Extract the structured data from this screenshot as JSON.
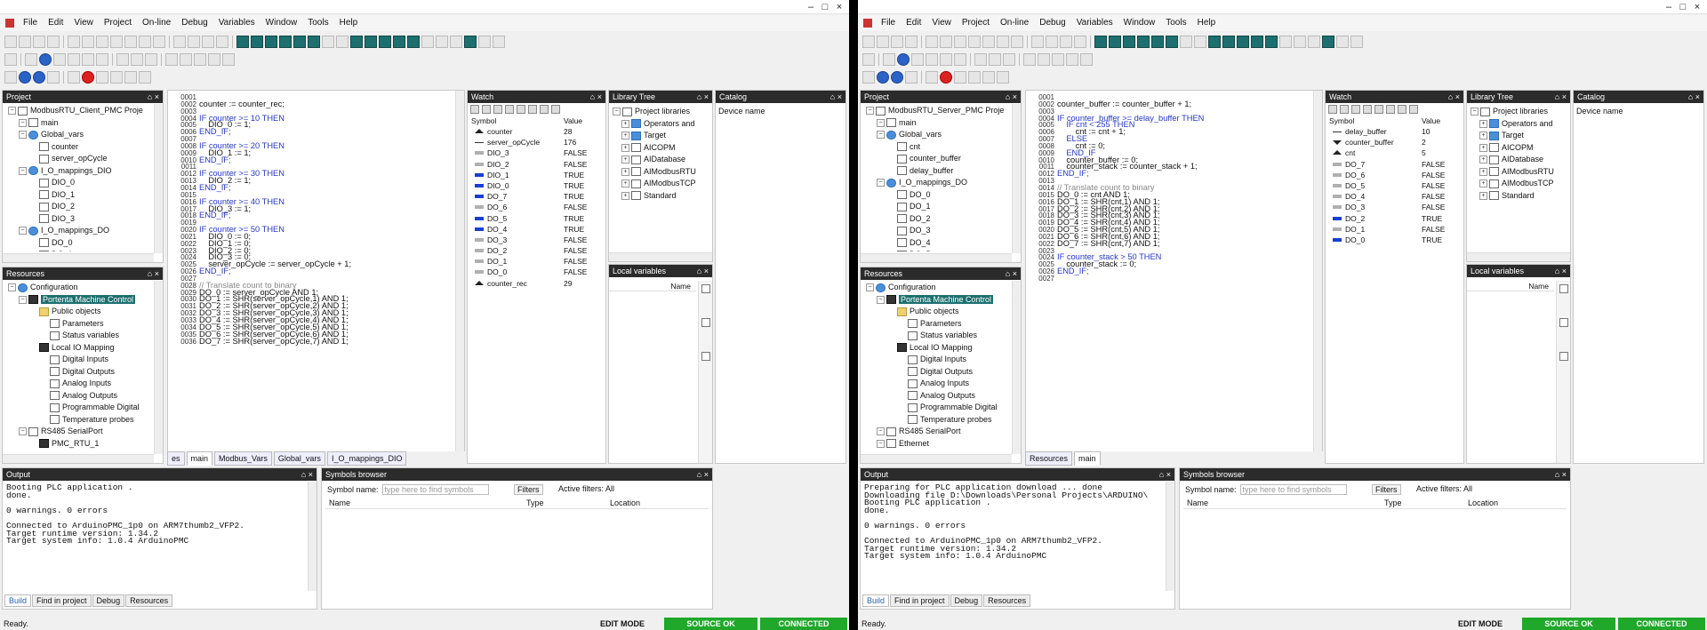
{
  "windows": [
    {
      "id": "left",
      "menu": [
        "File",
        "Edit",
        "View",
        "Project",
        "On-line",
        "Debug",
        "Variables",
        "Window",
        "Tools",
        "Help"
      ],
      "project_panel": {
        "title": "Project",
        "tree": [
          {
            "label": "ModbusRTU_Client_PMC Proje",
            "depth": 0,
            "icon": "project-icon"
          },
          {
            "label": "main",
            "depth": 1,
            "icon": "program-icon"
          },
          {
            "label": "Global_vars",
            "depth": 1,
            "icon": "globe-icon"
          },
          {
            "label": "counter",
            "depth": 2,
            "icon": "variable-icon"
          },
          {
            "label": "server_opCycle",
            "depth": 2,
            "icon": "variable-icon"
          },
          {
            "label": "I_O_mappings_DIO",
            "depth": 1,
            "icon": "globe-icon"
          },
          {
            "label": "DIO_0",
            "depth": 2,
            "icon": "io-icon"
          },
          {
            "label": "DIO_1",
            "depth": 2,
            "icon": "io-icon"
          },
          {
            "label": "DIO_2",
            "depth": 2,
            "icon": "io-icon"
          },
          {
            "label": "DIO_3",
            "depth": 2,
            "icon": "io-icon"
          },
          {
            "label": "I_O_mappings_DO",
            "depth": 1,
            "icon": "globe-icon"
          },
          {
            "label": "DO_0",
            "depth": 2,
            "icon": "io-icon"
          },
          {
            "label": "DO_1",
            "depth": 2,
            "icon": "io-icon"
          }
        ]
      },
      "resources_panel": {
        "title": "Resources",
        "tree": [
          {
            "label": "Configuration",
            "depth": 0,
            "icon": "config-icon"
          },
          {
            "label": "Portenta Machine Control",
            "depth": 1,
            "icon": "board-icon",
            "selected": true
          },
          {
            "label": "Public objects",
            "depth": 2,
            "icon": "folder-icon"
          },
          {
            "label": "Parameters",
            "depth": 3,
            "icon": "table-icon"
          },
          {
            "label": "Status variables",
            "depth": 3,
            "icon": "table-icon"
          },
          {
            "label": "Local IO Mapping",
            "depth": 2,
            "icon": "io-map-icon"
          },
          {
            "label": "Digital Inputs",
            "depth": 3,
            "icon": "io-icon"
          },
          {
            "label": "Digital Outputs",
            "depth": 3,
            "icon": "io-icon"
          },
          {
            "label": "Analog Inputs",
            "depth": 3,
            "icon": "io-icon"
          },
          {
            "label": "Analog Outputs",
            "depth": 3,
            "icon": "io-icon"
          },
          {
            "label": "Programmable Digital",
            "depth": 3,
            "icon": "io-icon"
          },
          {
            "label": "Temperature probes",
            "depth": 3,
            "icon": "io-icon"
          },
          {
            "label": "RS485 SerialPort",
            "depth": 1,
            "icon": "port-icon"
          },
          {
            "label": "PMC_RTU_1",
            "depth": 2,
            "icon": "device-icon"
          }
        ]
      },
      "editor": {
        "line_numbers": [
          "0001",
          "0002",
          "0003",
          "0004",
          "0005",
          "0006",
          "0007",
          "0008",
          "0009",
          "0010",
          "0011",
          "0012",
          "0013",
          "0014",
          "0015",
          "0016",
          "0017",
          "0018",
          "0019",
          "0020",
          "0021",
          "0022",
          "0023",
          "0024",
          "0025",
          "0026",
          "0027",
          "0028",
          "0029",
          "0030",
          "0031",
          "0032",
          "0033",
          "0034",
          "0035",
          "0036"
        ],
        "lines": [
          "",
          "counter := counter_rec;",
          "",
          "IF counter >= 10 THEN",
          "    DIO_0 := 1;",
          "END_IF;",
          "",
          "IF counter >= 20 THEN",
          "    DIO_1 := 1;",
          "END_IF;",
          "",
          "IF counter >= 30 THEN",
          "    DIO_2 := 1;",
          "END_IF;",
          "",
          "IF counter >= 40 THEN",
          "    DIO_3 := 1;",
          "END_IF;",
          "",
          "IF counter >= 50 THEN",
          "    DIO_0 := 0;",
          "    DIO_1 := 0;",
          "    DIO_2 := 0;",
          "    DIO_3 := 0;",
          "    server_opCycle := server_opCycle + 1;",
          "END_IF;",
          "",
          "// Translate count to binary",
          "DO_0 := server_opCycle AND 1;",
          "DO_1 := SHR(server_opCycle,1) AND 1;",
          "DO_2 := SHR(server_opCycle,2) AND 1;",
          "DO_3 := SHR(server_opCycle,3) AND 1;",
          "DO_4 := SHR(server_opCycle,4) AND 1;",
          "DO_5 := SHR(server_opCycle,5) AND 1;",
          "DO_6 := SHR(server_opCycle,6) AND 1;",
          "DO_7 := SHR(server_opCycle,7) AND 1;"
        ],
        "tabs": [
          "es",
          "main",
          "Modbus_Vars",
          "Global_vars",
          "I_O_mappings_DIO"
        ]
      },
      "watch": {
        "title": "Watch",
        "col_symbol": "Symbol",
        "col_value": "Value",
        "rows": [
          {
            "name": "counter",
            "value": "28",
            "marker": "up"
          },
          {
            "name": "server_opCycle",
            "value": "176",
            "marker": "line"
          },
          {
            "name": "DIO_3",
            "value": "FALSE",
            "marker": "gray"
          },
          {
            "name": "DIO_2",
            "value": "FALSE",
            "marker": "gray"
          },
          {
            "name": "DIO_1",
            "value": "TRUE",
            "marker": "blue"
          },
          {
            "name": "DIO_0",
            "value": "TRUE",
            "marker": "blue"
          },
          {
            "name": "DO_7",
            "value": "TRUE",
            "marker": "blue"
          },
          {
            "name": "DO_6",
            "value": "FALSE",
            "marker": "gray"
          },
          {
            "name": "DO_5",
            "value": "TRUE",
            "marker": "blue"
          },
          {
            "name": "DO_4",
            "value": "TRUE",
            "marker": "blue"
          },
          {
            "name": "DO_3",
            "value": "FALSE",
            "marker": "gray"
          },
          {
            "name": "DO_2",
            "value": "FALSE",
            "marker": "gray"
          },
          {
            "name": "DO_1",
            "value": "FALSE",
            "marker": "gray"
          },
          {
            "name": "DO_0",
            "value": "FALSE",
            "marker": "gray"
          },
          {
            "name": "counter_rec",
            "value": "29",
            "marker": "up"
          }
        ]
      },
      "library": {
        "title": "Library Tree",
        "root": "Project libraries",
        "items": [
          "Operators and",
          "Target",
          "AICOPM",
          "AIDatabase",
          "AIModbusRTU",
          "AIModbusTCP",
          "Standard"
        ]
      },
      "local_vars": {
        "title": "Local variables",
        "col_name": "Name"
      },
      "catalog": {
        "title": "Catalog",
        "label": "Device name"
      },
      "output": {
        "title": "Output",
        "lines": [
          "Booting PLC application .",
          "done.",
          "",
          "0 warnings. 0 errors",
          "",
          "Connected to ArduinoPMC_1p0 on ARM7thumb2_VFP2.",
          "Target runtime version: 1.34.2",
          "Target system info: 1.0.4 ArduinoPMC"
        ],
        "tabs": [
          "Build",
          "Find in project",
          "Debug",
          "Resources"
        ]
      },
      "symbols": {
        "title": "Symbols browser",
        "name_label": "Symbol name:",
        "placeholder": "type here to find symbols",
        "filters": "Filters",
        "active_filters": "Active filters: All",
        "col_name": "Name",
        "col_type": "Type",
        "col_location": "Location"
      },
      "status": {
        "ready": "Ready.",
        "mode": "EDIT MODE",
        "source": "SOURCE OK",
        "conn": "CONNECTED"
      }
    },
    {
      "id": "right",
      "menu": [
        "File",
        "Edit",
        "View",
        "Project",
        "On-line",
        "Debug",
        "Variables",
        "Window",
        "Tools",
        "Help"
      ],
      "project_panel": {
        "title": "Project",
        "tree": [
          {
            "label": "ModbusRTU_Server_PMC Proje",
            "depth": 0,
            "icon": "project-icon"
          },
          {
            "label": "main",
            "depth": 1,
            "icon": "program-icon"
          },
          {
            "label": "Global_vars",
            "depth": 1,
            "icon": "globe-icon"
          },
          {
            "label": "cnt",
            "depth": 2,
            "icon": "variable-icon"
          },
          {
            "label": "counter_buffer",
            "depth": 2,
            "icon": "variable-icon"
          },
          {
            "label": "delay_buffer",
            "depth": 2,
            "icon": "variable-icon"
          },
          {
            "label": "I_O_mappings_DO",
            "depth": 1,
            "icon": "globe-icon"
          },
          {
            "label": "DO_0",
            "depth": 2,
            "icon": "io-icon"
          },
          {
            "label": "DO_1",
            "depth": 2,
            "icon": "io-icon"
          },
          {
            "label": "DO_2",
            "depth": 2,
            "icon": "io-icon"
          },
          {
            "label": "DO_3",
            "depth": 2,
            "icon": "io-icon"
          },
          {
            "label": "DO_4",
            "depth": 2,
            "icon": "io-icon"
          },
          {
            "label": "DO_5",
            "depth": 2,
            "icon": "io-icon"
          }
        ]
      },
      "resources_panel": {
        "title": "Resources",
        "tree": [
          {
            "label": "Configuration",
            "depth": 0,
            "icon": "config-icon"
          },
          {
            "label": "Portenta Machine Control",
            "depth": 1,
            "icon": "board-icon",
            "selected": true
          },
          {
            "label": "Public objects",
            "depth": 2,
            "icon": "folder-icon"
          },
          {
            "label": "Parameters",
            "depth": 3,
            "icon": "table-icon"
          },
          {
            "label": "Status variables",
            "depth": 3,
            "icon": "table-icon"
          },
          {
            "label": "Local IO Mapping",
            "depth": 2,
            "icon": "io-map-icon"
          },
          {
            "label": "Digital Inputs",
            "depth": 3,
            "icon": "io-icon"
          },
          {
            "label": "Digital Outputs",
            "depth": 3,
            "icon": "io-icon"
          },
          {
            "label": "Analog Inputs",
            "depth": 3,
            "icon": "io-icon"
          },
          {
            "label": "Analog Outputs",
            "depth": 3,
            "icon": "io-icon"
          },
          {
            "label": "Programmable Digital",
            "depth": 3,
            "icon": "io-icon"
          },
          {
            "label": "Temperature probes",
            "depth": 3,
            "icon": "io-icon"
          },
          {
            "label": "RS485 SerialPort",
            "depth": 1,
            "icon": "port-icon"
          },
          {
            "label": "Ethernet",
            "depth": 1,
            "icon": "port-icon"
          }
        ]
      },
      "editor": {
        "line_numbers": [
          "0001",
          "0002",
          "0003",
          "0004",
          "0005",
          "0006",
          "0007",
          "0008",
          "0009",
          "0010",
          "0011",
          "0012",
          "0013",
          "0014",
          "0015",
          "0016",
          "0017",
          "0018",
          "0019",
          "0020",
          "0021",
          "0022",
          "0023",
          "0024",
          "0025",
          "0026",
          "0027"
        ],
        "lines": [
          "",
          "counter_buffer := counter_buffer + 1;",
          "",
          "IF counter_buffer >= delay_buffer THEN",
          "    IF cnt < 255 THEN",
          "        cnt := cnt + 1;",
          "    ELSE",
          "        cnt := 0;",
          "    END_IF",
          "    counter_buffer := 0;",
          "    counter_stack := counter_stack + 1;",
          "END_IF;",
          "",
          "// Translate count to binary",
          "DO_0 := cnt AND 1;",
          "DO_1 := SHR(cnt,1) AND 1;",
          "DO_2 := SHR(cnt,2) AND 1;",
          "DO_3 := SHR(cnt,3) AND 1;",
          "DO_4 := SHR(cnt,4) AND 1;",
          "DO_5 := SHR(cnt,5) AND 1;",
          "DO_6 := SHR(cnt,6) AND 1;",
          "DO_7 := SHR(cnt,7) AND 1;",
          "",
          "IF counter_stack > 50 THEN",
          "    counter_stack := 0;",
          "END_IF;",
          ""
        ],
        "tabs": [
          "Resources",
          "main"
        ]
      },
      "watch": {
        "title": "Watch",
        "col_symbol": "Symbol",
        "col_value": "Value",
        "rows": [
          {
            "name": "delay_buffer",
            "value": "10",
            "marker": "line"
          },
          {
            "name": "counter_buffer",
            "value": "2",
            "marker": "down"
          },
          {
            "name": "cnt",
            "value": "5",
            "marker": "up"
          },
          {
            "name": "DO_7",
            "value": "FALSE",
            "marker": "gray"
          },
          {
            "name": "DO_6",
            "value": "FALSE",
            "marker": "gray"
          },
          {
            "name": "DO_5",
            "value": "FALSE",
            "marker": "gray"
          },
          {
            "name": "DO_4",
            "value": "FALSE",
            "marker": "gray"
          },
          {
            "name": "DO_3",
            "value": "FALSE",
            "marker": "gray"
          },
          {
            "name": "DO_2",
            "value": "TRUE",
            "marker": "blue"
          },
          {
            "name": "DO_1",
            "value": "FALSE",
            "marker": "gray"
          },
          {
            "name": "DO_0",
            "value": "TRUE",
            "marker": "blue"
          }
        ]
      },
      "library": {
        "title": "Library Tree",
        "root": "Project libraries",
        "items": [
          "Operators and",
          "Target",
          "AICOPM",
          "AIDatabase",
          "AIModbusRTU",
          "AIModbusTCP",
          "Standard"
        ]
      },
      "local_vars": {
        "title": "Local variables",
        "col_name": "Name"
      },
      "catalog": {
        "title": "Catalog",
        "label": "Device name"
      },
      "output": {
        "title": "Output",
        "lines": [
          "Preparing for PLC application download ... done",
          "Downloading file D:\\Downloads\\Personal Projects\\ARDUINO\\",
          "Booting PLC application .",
          "done.",
          "",
          "0 warnings. 0 errors",
          "",
          "Connected to ArduinoPMC_1p0 on ARM7thumb2_VFP2.",
          "Target runtime version: 1.34.2",
          "Target system info: 1.0.4 ArduinoPMC"
        ],
        "tabs": [
          "Build",
          "Find in project",
          "Debug",
          "Resources"
        ]
      },
      "symbols": {
        "title": "Symbols browser",
        "name_label": "Symbol name:",
        "placeholder": "type here to find symbols",
        "filters": "Filters",
        "active_filters": "Active filters: All",
        "col_name": "Name",
        "col_type": "Type",
        "col_location": "Location"
      },
      "status": {
        "ready": "Ready.",
        "mode": "EDIT MODE",
        "source": "SOURCE OK",
        "conn": "CONNECTED"
      }
    }
  ],
  "colors": {
    "dark_header": "#2b2b2b",
    "accent_teal": "#1d6f6f",
    "status_green": "#1fa82a",
    "keyword_blue": "#2437c8",
    "true_marker": "#1a3fcf",
    "false_marker": "#b0b0b0"
  }
}
